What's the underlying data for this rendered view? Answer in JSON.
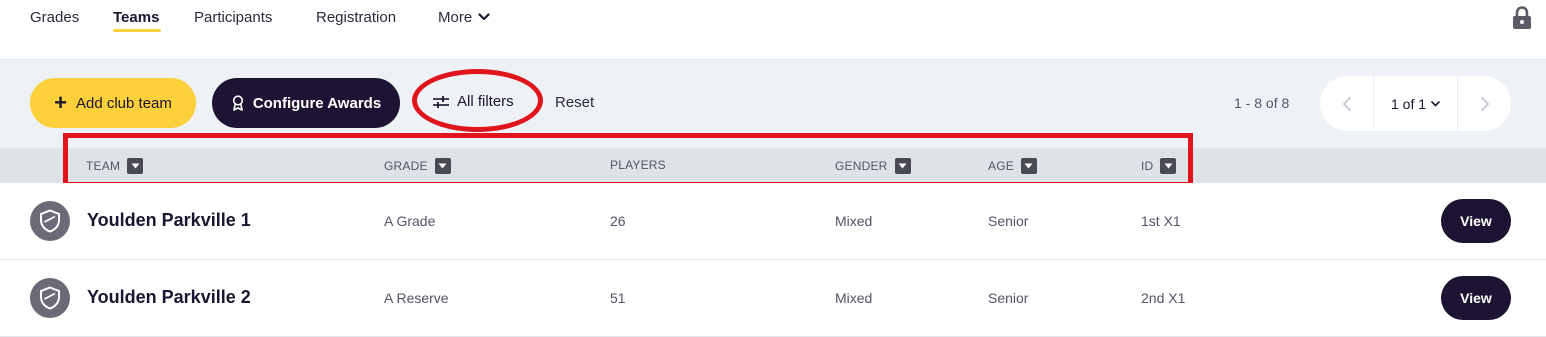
{
  "nav": {
    "items": [
      {
        "label": "Grades"
      },
      {
        "label": "Teams"
      },
      {
        "label": "Participants"
      },
      {
        "label": "Registration"
      },
      {
        "label": "More"
      }
    ],
    "active": "Teams"
  },
  "toolbar": {
    "add_label": "Add club team",
    "awards_label": "Configure Awards",
    "filters_label": "All filters",
    "reset_label": "Reset",
    "count_label": "1 - 8 of 8",
    "page_label": "1 of 1"
  },
  "table": {
    "headers": [
      "TEAM",
      "GRADE",
      "PLAYERS",
      "GENDER",
      "AGE",
      "ID"
    ],
    "rows": [
      {
        "team": "Youlden Parkville 1",
        "grade": "A Grade",
        "players": "26",
        "gender": "Mixed",
        "age": "Senior",
        "id": "1st X1",
        "action": "View"
      },
      {
        "team": "Youlden Parkville 2",
        "grade": "A Reserve",
        "players": "51",
        "gender": "Mixed",
        "age": "Senior",
        "id": "2nd X1",
        "action": "View"
      }
    ]
  },
  "colors": {
    "accent_yellow": "#fcd03a",
    "brand_dark": "#1d1433",
    "annotation_red": "#e0141b"
  },
  "icons": [
    "chevron-down-icon",
    "lock-icon",
    "plus-icon",
    "award-icon",
    "sliders-icon",
    "chevron-left-icon",
    "chevron-right-icon",
    "sort-icon",
    "shield-icon"
  ]
}
